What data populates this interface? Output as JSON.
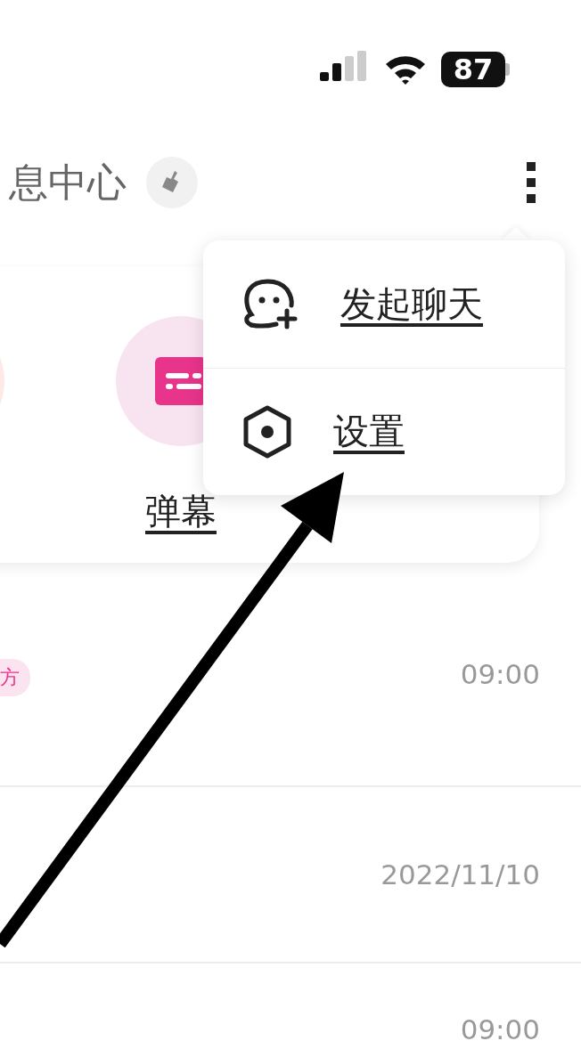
{
  "status_bar": {
    "battery": "87"
  },
  "header": {
    "title": "息中心"
  },
  "quick_actions": [
    {
      "kind": "danmaku",
      "label": "弹幕"
    }
  ],
  "messages": [
    {
      "tag": "方",
      "time": "09:00"
    },
    {
      "time": "2022/11/10"
    },
    {
      "time": "09:00"
    }
  ],
  "menu": {
    "items": [
      {
        "kind": "chat",
        "label": "发起聊天"
      },
      {
        "kind": "settings",
        "label": "设置"
      }
    ]
  }
}
